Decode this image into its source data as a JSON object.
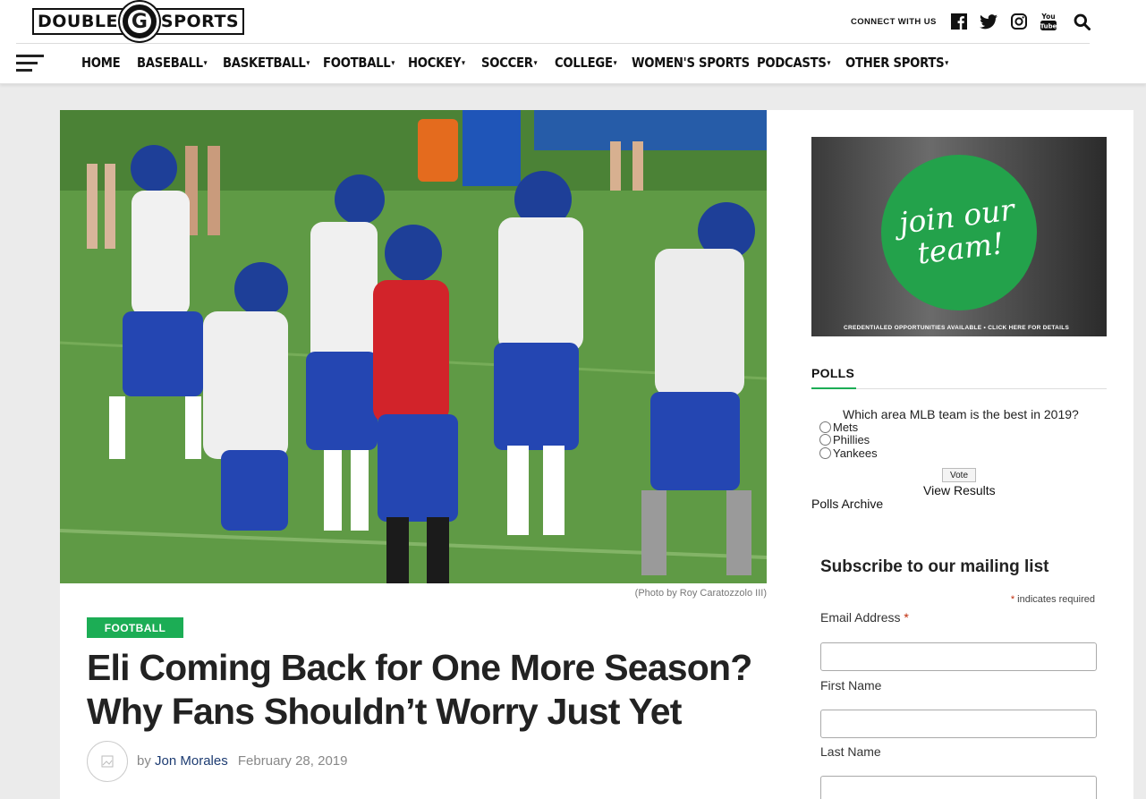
{
  "site": {
    "logo_left": "DOUBLE",
    "logo_mid": "G",
    "logo_right": "SPORTS"
  },
  "header": {
    "connect_label": "CONNECT WITH US",
    "social_icons": [
      "facebook-icon",
      "twitter-icon",
      "instagram-icon",
      "youtube-icon"
    ],
    "youtube_label": "You Tube"
  },
  "nav": {
    "items": [
      {
        "label": "HOME",
        "dropdown": false
      },
      {
        "label": "BASEBALL",
        "dropdown": true
      },
      {
        "label": "BASKETBALL",
        "dropdown": true
      },
      {
        "label": "FOOTBALL",
        "dropdown": true
      },
      {
        "label": "HOCKEY",
        "dropdown": true
      },
      {
        "label": "SOCCER",
        "dropdown": true
      },
      {
        "label": "COLLEGE",
        "dropdown": true
      },
      {
        "label": "WOMEN'S SPORTS",
        "dropdown": false
      },
      {
        "label": "PODCASTS",
        "dropdown": true
      },
      {
        "label": "OTHER SPORTS",
        "dropdown": true
      }
    ],
    "caret": "▾"
  },
  "article": {
    "photo_caption": "(Photo by Roy Caratozzolo III)",
    "category": "FOOTBALL",
    "headline": "Eli Coming Back for One More Season? Why Fans Shouldn’t Worry Just Yet",
    "by": "by",
    "author": "Jon Morales",
    "date": "February 28, 2019"
  },
  "sidebar": {
    "ad": {
      "headline_line1": "join our",
      "headline_line2": "team!",
      "footer": "CREDENTIALED OPPORTUNITIES AVAILABLE • CLICK HERE FOR DETAILS"
    },
    "polls": {
      "title": "POLLS",
      "question": "Which area MLB team is the best in 2019?",
      "options": [
        "Mets",
        "Phillies",
        "Yankees"
      ],
      "vote_label": "Vote",
      "view_results": "View Results",
      "archive": "Polls Archive"
    },
    "subscribe": {
      "title": "Subscribe to our mailing list",
      "required_note": "indicates required",
      "email_label": "Email Address",
      "first_name_label": "First Name",
      "last_name_label": "Last Name"
    }
  },
  "colors": {
    "accent_green": "#1cad55",
    "author_blue": "#1d3c72",
    "required_red": "#c02b0a"
  }
}
